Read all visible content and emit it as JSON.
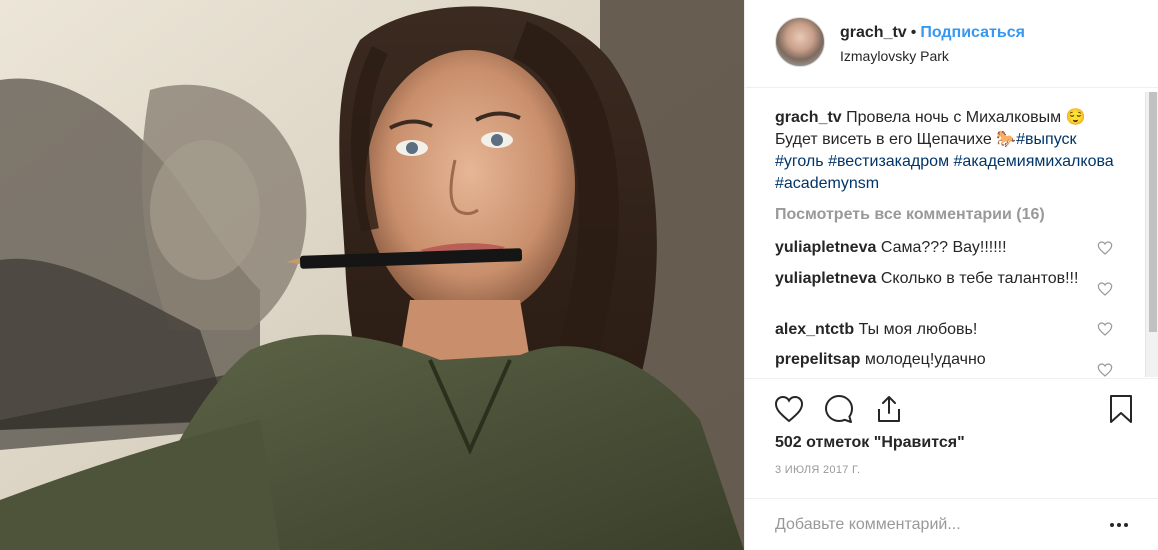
{
  "header": {
    "username": "grach_tv",
    "separator": "•",
    "follow_label": "Подписаться",
    "location": "Izmaylovsky Park"
  },
  "caption": {
    "username": "grach_tv",
    "text": "Провела ночь с Михалковым 😌 Будет висеть в его Щепачихе 🐎",
    "tags": [
      "#выпуск",
      "#уголь",
      "#вестизакадром",
      "#академиямихалкова",
      "#academynsm"
    ]
  },
  "view_all_label": "Посмотреть все комментарии (16)",
  "comments": [
    {
      "user": "yuliapletneva",
      "text": "Сама??? Вау!!!!!!"
    },
    {
      "user": "yuliapletneva",
      "text": "Сколько в тебе талантов!!!"
    },
    {
      "user": "alex_ntctb",
      "text": "Ты моя любовь!"
    },
    {
      "user": "prepelitsap",
      "text": "молодец!удачно"
    }
  ],
  "likes_label": "502 отметок \"Нравится\"",
  "date": "3 ИЮЛЯ 2017 Г.",
  "add_comment_placeholder": "Добавьте комментарий...",
  "icons": {
    "like": "heart-icon",
    "comment": "comment-icon",
    "share": "share-icon",
    "save": "bookmark-icon",
    "more": "more-options-icon"
  },
  "colors": {
    "link_blue": "#3897f0",
    "hashtag": "#003569",
    "muted": "#999999",
    "text": "#262626"
  }
}
